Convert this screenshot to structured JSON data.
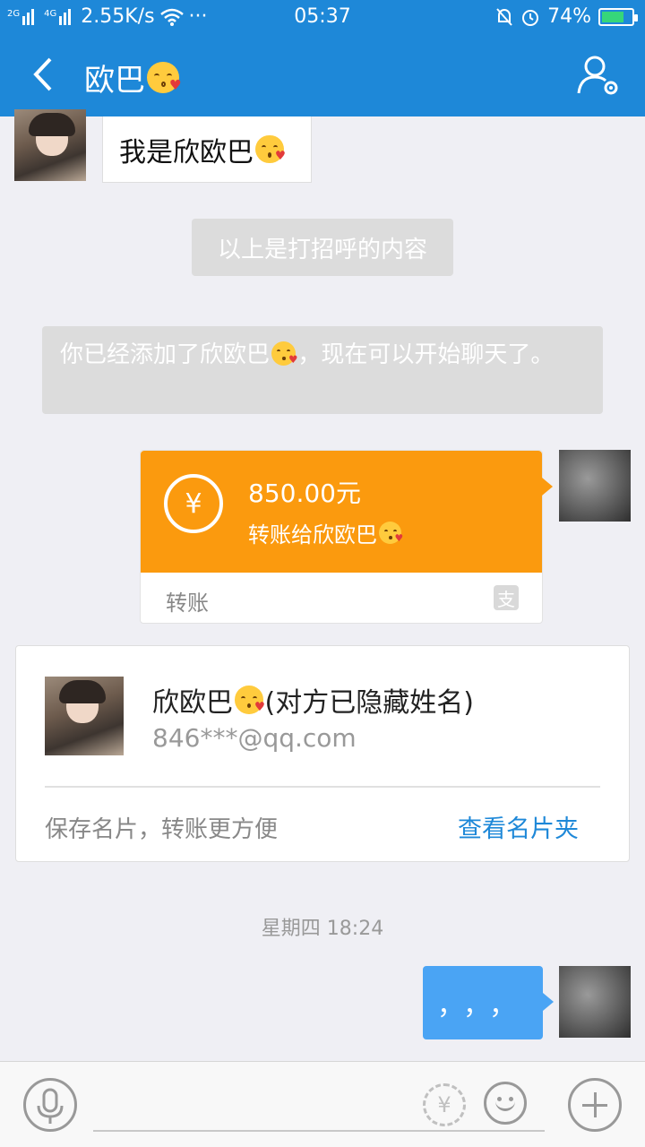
{
  "status_bar": {
    "network_2g": "2G",
    "network_4g": "4G",
    "speed": "2.55K/s",
    "more": "···",
    "time": "05:37",
    "battery": "74%",
    "battery_level": 0.74
  },
  "header": {
    "title": "欧巴",
    "title_emoji_icon": "kissing-face-icon"
  },
  "messages": {
    "greeting_text": "我是欣欧巴",
    "system_note_1": "以上是打招呼的内容",
    "system_note_2_prefix": "你已经添加了欣欧巴",
    "system_note_2_suffix": "，现在可以开始聊天了。"
  },
  "transfer": {
    "amount": "850.00元",
    "description": "转账给欣欧巴",
    "label": "转账",
    "currency_symbol": "¥",
    "alipay_glyph": "支"
  },
  "contact_card": {
    "name_prefix": "欣欧巴",
    "name_suffix": "(对方已隐藏姓名)",
    "email": "846***@qq.com",
    "save_hint": "保存名片，转账更方便",
    "view_cards": "查看名片夹"
  },
  "timestamp": "星期四 18:24",
  "last_message": "，，，",
  "input_bar": {
    "yen_symbol": "¥",
    "placeholder": ""
  },
  "colors": {
    "primary": "#1e88d8",
    "transfer": "#fb9a0e",
    "bubble_self": "#4aa4f4"
  }
}
